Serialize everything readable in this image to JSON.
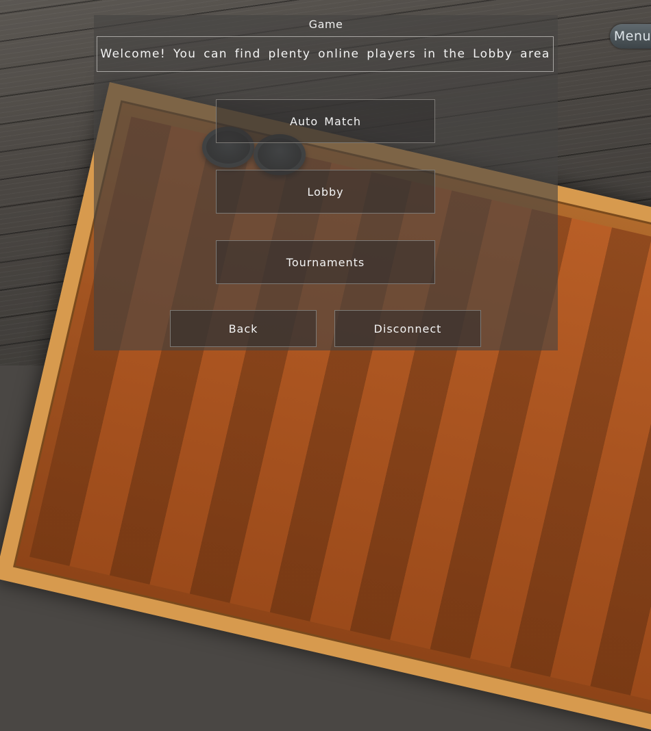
{
  "panel": {
    "title": "Game",
    "welcome_message": "Welcome! You can find plenty online players in the Lobby area"
  },
  "menu": {
    "auto_match_label": "Auto Match",
    "lobby_label": "Lobby",
    "tournaments_label": "Tournaments",
    "back_label": "Back",
    "disconnect_label": "Disconnect"
  },
  "corner": {
    "menu_label": "Menu"
  }
}
